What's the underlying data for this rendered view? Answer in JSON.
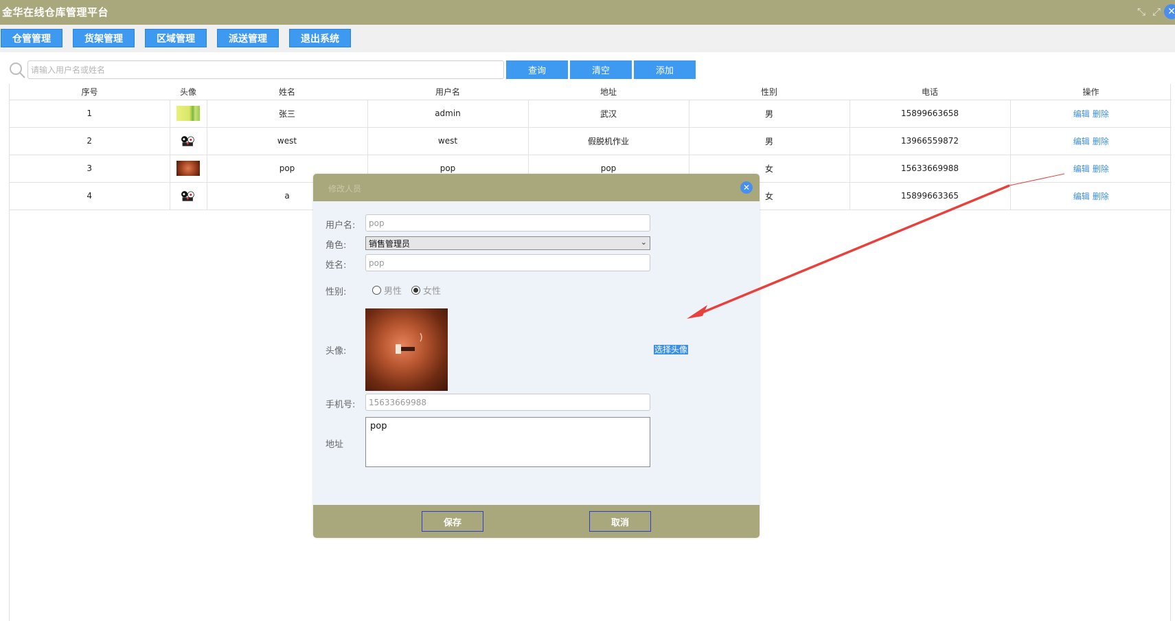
{
  "app": {
    "title": "金华在线仓库管理平台"
  },
  "window_controls": {
    "restore_icon": "⤡",
    "close_icon": "✕"
  },
  "nav": [
    {
      "label": "仓管管理"
    },
    {
      "label": "货架管理"
    },
    {
      "label": "区域管理"
    },
    {
      "label": "派送管理"
    },
    {
      "label": "退出系统"
    }
  ],
  "search": {
    "placeholder": "请输入用户名或姓名",
    "value": "",
    "query_label": "查询",
    "clear_label": "清空",
    "add_label": "添加"
  },
  "table": {
    "headers": [
      "序号",
      "头像",
      "姓名",
      "用户名",
      "地址",
      "性别",
      "电话",
      "操作"
    ],
    "rows": [
      {
        "index": "1",
        "avatar": "green-bamboo-avatar",
        "name": "张三",
        "username": "admin",
        "address": "武汉",
        "gender": "男",
        "phone": "15899663658",
        "edit": "编辑",
        "delete": "删除"
      },
      {
        "index": "2",
        "avatar": "cartoon-avatar",
        "name": "west",
        "username": "west",
        "address": "假脱机作业",
        "gender": "男",
        "phone": "13966559872",
        "edit": "编辑",
        "delete": "删除"
      },
      {
        "index": "3",
        "avatar": "brown-avatar",
        "name": "pop",
        "username": "pop",
        "address": "pop",
        "gender": "女",
        "phone": "15633669988",
        "edit": "编辑",
        "delete": "删除"
      },
      {
        "index": "4",
        "avatar": "cartoon-avatar",
        "name": "a",
        "username": "",
        "address": "",
        "gender": "女",
        "phone": "15899663365",
        "edit": "编辑",
        "delete": "删除"
      }
    ]
  },
  "modal": {
    "title": "修改人员",
    "username_label": "用户名:",
    "username_value": "pop",
    "role_label": "角色:",
    "role_value": "销售管理员",
    "name_label": "姓名:",
    "name_value": "pop",
    "gender_label": "性别:",
    "gender_male": "男性",
    "gender_female": "女性",
    "gender_selected": "女性",
    "avatar_label": "头像:",
    "choose_avatar_label": "选择头像",
    "phone_label": "手机号:",
    "phone_value": "15633669988",
    "address_label": "地址",
    "address_value": "pop",
    "save_label": "保存",
    "cancel_label": "取消"
  },
  "colors": {
    "header_bg": "#a8a87c",
    "button_blue": "#3d9af0",
    "link_blue": "#3d8fe0",
    "annotation_red": "#e8413c"
  }
}
